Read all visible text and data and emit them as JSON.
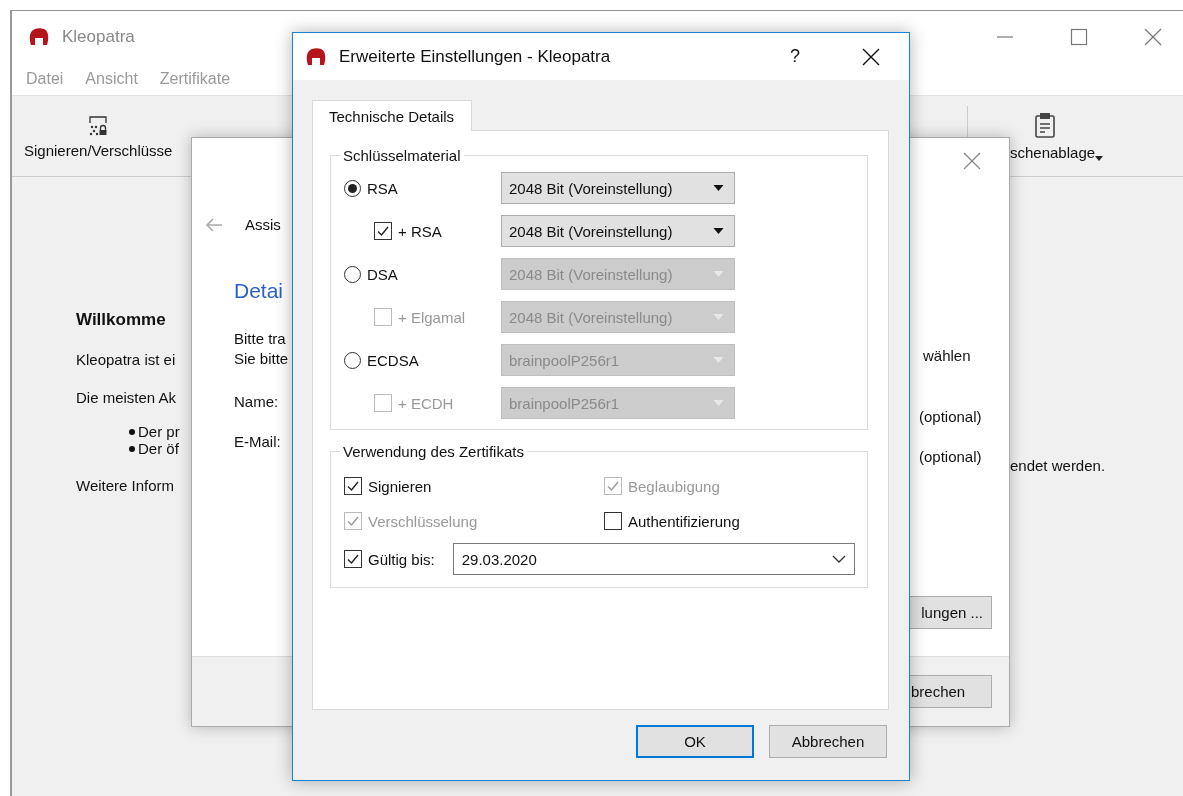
{
  "main_window": {
    "title": "Kleopatra",
    "menu": [
      "Datei",
      "Ansicht",
      "Zertifikate"
    ],
    "toolbar": [
      {
        "kind": "sign",
        "label": "Signieren/Verschlüsse"
      },
      {
        "kind": "clipboard",
        "label": "schenablage"
      }
    ],
    "welcome": {
      "heading": "Willkomme",
      "lines": [
        "Kleopatra ist ei",
        "Die meisten Ak"
      ],
      "bullets": [
        "Der pr",
        "Der öf"
      ],
      "more": "Weitere Inform",
      "tail": "endet werden."
    }
  },
  "wizard": {
    "title": "Assis",
    "heading": "Detai",
    "intro": [
      "Bitte tra",
      "Sie bitte"
    ],
    "intro_tail": "wählen",
    "fields": [
      {
        "label": "Name:",
        "hint": "(optional)"
      },
      {
        "label": "E-Mail:",
        "hint": "(optional)"
      }
    ],
    "settings_button": "lungen ...",
    "cancel_button": "brechen"
  },
  "dialog": {
    "title": "Erweiterte Einstellungen - Kleopatra",
    "help": "?",
    "tabs": [
      {
        "label": "Technische Details",
        "selected": true
      }
    ],
    "key_material": {
      "title": "Schlüsselmaterial",
      "rows": [
        {
          "kind": "radio",
          "label": "RSA",
          "selected": true,
          "disabled": false,
          "value": "2048 Bit (Voreinstellung)",
          "value_disabled": false
        },
        {
          "kind": "checkbox",
          "label": "+ RSA",
          "checked": true,
          "disabled": false,
          "value": "2048 Bit (Voreinstellung)",
          "value_disabled": false
        },
        {
          "kind": "radio",
          "label": "DSA",
          "selected": false,
          "disabled": false,
          "value": "2048 Bit (Voreinstellung)",
          "value_disabled": true
        },
        {
          "kind": "checkbox",
          "label": "+ Elgamal",
          "checked": false,
          "disabled": true,
          "value": "2048 Bit (Voreinstellung)",
          "value_disabled": true
        },
        {
          "kind": "radio",
          "label": "ECDSA",
          "selected": false,
          "disabled": false,
          "value": "brainpoolP256r1",
          "value_disabled": true
        },
        {
          "kind": "checkbox",
          "label": "+ ECDH",
          "checked": false,
          "disabled": true,
          "value": "brainpoolP256r1",
          "value_disabled": true
        }
      ]
    },
    "usage": {
      "title": "Verwendung des Zertifikats",
      "options": [
        {
          "label": "Signieren",
          "checked": true,
          "disabled": false
        },
        {
          "label": "Beglaubigung",
          "checked": true,
          "disabled": true
        },
        {
          "label": "Verschlüsselung",
          "checked": true,
          "disabled": true
        },
        {
          "label": "Authentifizierung",
          "checked": false,
          "disabled": false
        }
      ],
      "validity": {
        "label": "Gültig bis:",
        "checked": true,
        "value": "29.03.2020"
      }
    },
    "buttons": [
      {
        "label": "OK",
        "default": true
      },
      {
        "label": "Abbrechen",
        "default": false
      }
    ]
  }
}
